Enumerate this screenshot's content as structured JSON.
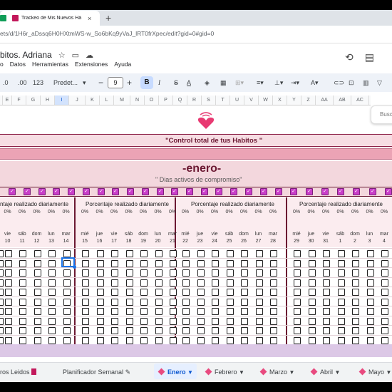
{
  "browser": {
    "tab_title": "Trackeo de Mis Nuevos Há",
    "new_tab": "+",
    "close": "×",
    "url": "ets/d/1H6r_aDssq6H0HXtmWS-w_So6bKq9yVaJ_lRT0frXpec/edit?gid=0#gid=0"
  },
  "doc": {
    "title": "bitos. Adriana"
  },
  "menu": [
    "o",
    "Datos",
    "Herramientas",
    "Extensiones",
    "Ayuda"
  ],
  "toolbar": {
    "dec_dec": ".0",
    "inc_dec": ".00",
    "num": "123",
    "font": "Predet...",
    "font_size": "9",
    "bold": "B",
    "italic": "I",
    "strike": "S",
    "color": "A"
  },
  "columns": [
    "E",
    "F",
    "G",
    "H",
    "I",
    "J",
    "K",
    "L",
    "M",
    "N",
    "O",
    "P",
    "Q",
    "R",
    "S",
    "T",
    "U",
    "V",
    "W",
    "X",
    "Y",
    "Z",
    "AA",
    "AB",
    "AC"
  ],
  "search": {
    "placeholder": "Busc"
  },
  "sheet": {
    "control_title": "\"Control total de tus Habitos \"",
    "month": "-enero-",
    "subtitle": "\" Dias activos de compromiso\"",
    "pct_label": "Porcentaje realizado diariamente",
    "pct_label_partial": "ntaje realizado diariamente",
    "zero": "0%",
    "weeks": [
      {
        "days": [
          [
            "vie",
            "10"
          ],
          [
            "sáb",
            "11"
          ],
          [
            "dom",
            "12"
          ],
          [
            "lun",
            "13"
          ],
          [
            "mar",
            "14"
          ]
        ]
      },
      {
        "days": [
          [
            "mié",
            "15"
          ],
          [
            "jue",
            "16"
          ],
          [
            "vie",
            "17"
          ],
          [
            "sáb",
            "18"
          ],
          [
            "dom",
            "19"
          ],
          [
            "lun",
            "20"
          ],
          [
            "mar",
            "21"
          ]
        ]
      },
      {
        "days": [
          [
            "mié",
            "22"
          ],
          [
            "jue",
            "23"
          ],
          [
            "vie",
            "24"
          ],
          [
            "sáb",
            "25"
          ],
          [
            "dom",
            "26"
          ],
          [
            "lun",
            "27"
          ],
          [
            "mar",
            "28"
          ]
        ]
      },
      {
        "days": [
          [
            "mié",
            "29"
          ],
          [
            "jue",
            "30"
          ],
          [
            "vie",
            "31"
          ],
          [
            "sáb",
            "1"
          ],
          [
            "dom",
            "2"
          ],
          [
            "lun",
            "3"
          ],
          [
            "mar",
            "4"
          ]
        ]
      }
    ]
  },
  "sheet_tabs": [
    "ros Leidos",
    "Planificador Semanal",
    "Enero",
    "Febrero",
    "Marzo",
    "Abril",
    "Mayo"
  ],
  "colors": {
    "accent": "#6b1832",
    "pink": "#e84a7f",
    "check": "#c93fc9"
  }
}
